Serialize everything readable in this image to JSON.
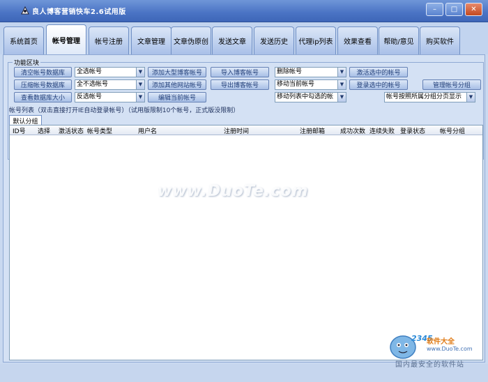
{
  "window": {
    "title": "良人博客营销快车2.6试用版"
  },
  "nav": {
    "tabs": [
      "系统首页",
      "帐号管理",
      "帐号注册",
      "文章管理",
      "文章伪原创",
      "发送文章",
      "发送历史",
      "代理ip列表",
      "效果查看",
      "帮助/意见",
      "购买软件"
    ],
    "active_index": 1
  },
  "function_area": {
    "title": "功能区块",
    "buttons": {
      "clear_db": "清空帐号数据库",
      "compress_db": "压缩帐号数据库",
      "view_db_size": "查看数据库大小",
      "add_big_blog": "添加大型博客帐号",
      "add_other_site": "添加其他网站帐号",
      "edit_current": "编辑当前帐号",
      "import_blog": "导入博客帐号",
      "export_blog": "导出博客帐号",
      "activate_selected": "激活选中的帐号",
      "login_selected": "登录选中的帐号",
      "manage_groups": "管理帐号分组"
    },
    "selects": {
      "select_all": "全选帐号",
      "select_none": "全不选帐号",
      "select_invert": "反选帐号",
      "delete_account": "删除帐号",
      "move_current": "移动当前帐号",
      "move_checked": "移动列表中勾选的帐",
      "page_by_group": "帐号按照所属分组分页显示"
    }
  },
  "account_list": {
    "label": "帐号列表（双击直接打开IE自动登录帐号）（试用版限制10个帐号，正式版没限制）",
    "group_tab": "默认分组",
    "columns": [
      "ID号",
      "选择",
      "激活状态",
      "帐号类型",
      "用户名",
      "注册时间",
      "注册邮箱",
      "成功次数",
      "连续失败",
      "登录状态",
      "帐号分组"
    ],
    "rows": []
  },
  "watermark": {
    "text": "www.DuoTe.com"
  },
  "corner_logo": {
    "brand_num": "2345",
    "brand_cn": "软件大全",
    "url": "www.DuoTe.com",
    "slogan": "国内最安全的软件站"
  },
  "colors": {
    "title_bar": "#4a73c4",
    "background": "#c9d9f0",
    "button_text": "#23407a"
  }
}
